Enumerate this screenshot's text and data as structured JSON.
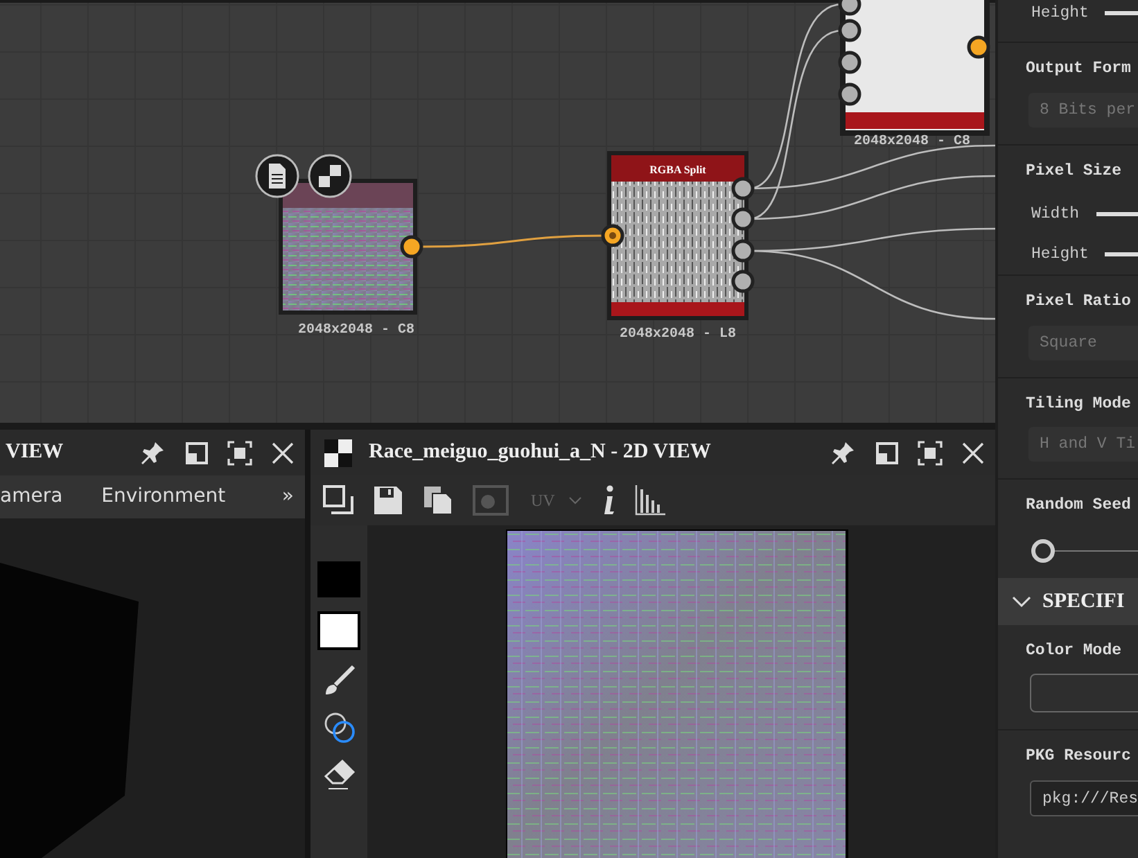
{
  "graph": {
    "nodes": [
      {
        "kind": "output",
        "caption": "2048x2048 - C8"
      },
      {
        "kind": "bitmap",
        "caption": "2048x2048 - C8"
      },
      {
        "kind": "split",
        "title": "RGBA Split",
        "caption": "2048x2048 - L8"
      }
    ]
  },
  "view_3d": {
    "title": "VIEW",
    "tabs": [
      {
        "label": "amera"
      },
      {
        "label": "Environment"
      }
    ],
    "overflow": "»"
  },
  "view_2d": {
    "title": "Race_meiguo_guohui_a_N - 2D VIEW",
    "channel_dropdown": "UV"
  },
  "properties": {
    "items": [
      {
        "kind": "slider",
        "label": "Height"
      },
      {
        "kind": "heading",
        "label": "Output Form"
      },
      {
        "kind": "select",
        "value": "8 Bits per"
      },
      {
        "kind": "heading",
        "label": "Pixel Size"
      },
      {
        "kind": "slider",
        "label": "Width"
      },
      {
        "kind": "slider",
        "label": "Height"
      },
      {
        "kind": "heading",
        "label": "Pixel Ratio"
      },
      {
        "kind": "select",
        "value": "Square"
      },
      {
        "kind": "heading",
        "label": "Tiling Mode"
      },
      {
        "kind": "select",
        "value": "H and V Ti"
      },
      {
        "kind": "heading",
        "label": "Random Seed"
      },
      {
        "kind": "seed",
        "level": 0
      },
      {
        "kind": "section",
        "label": "SPECIFI",
        "expanded": true
      },
      {
        "kind": "heading",
        "label": "Color Mode"
      },
      {
        "kind": "blank_field"
      },
      {
        "kind": "heading",
        "label": "PKG Resourc"
      },
      {
        "kind": "field",
        "value": "pkg:///Res"
      }
    ]
  }
}
